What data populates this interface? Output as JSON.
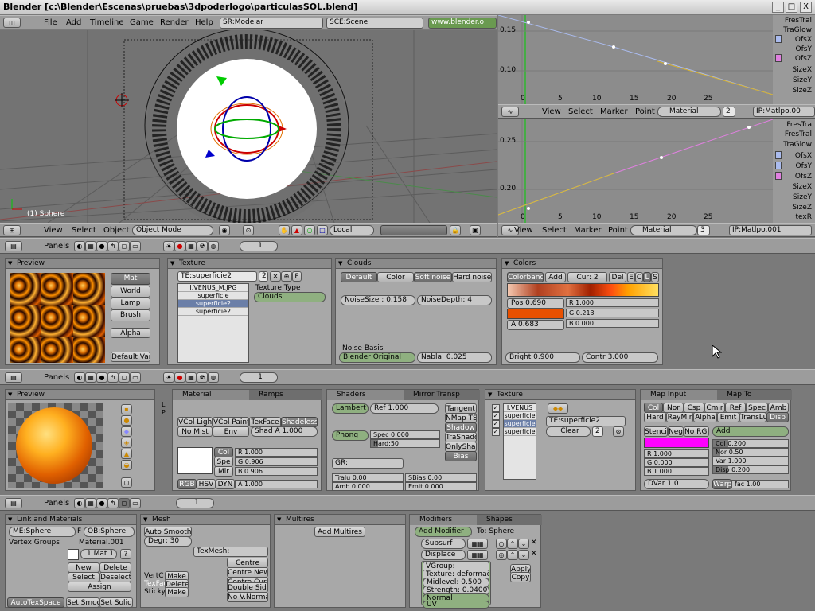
{
  "window": {
    "title": "Blender [c:\\Blender\\Escenas\\pruebas\\3dpoderlogo\\particulasSOL.blend]",
    "min": "_",
    "max": "□",
    "close": "X"
  },
  "topmenu": {
    "items": [
      "File",
      "Add",
      "Timeline",
      "Game",
      "Render",
      "Help"
    ],
    "screen": "SR:Modelar",
    "scene": "SCE:Scene",
    "url": "www.blender.o"
  },
  "view3d": {
    "object_label": "(1) Sphere",
    "menu": [
      "View",
      "Select",
      "Object"
    ],
    "mode": "Object Mode",
    "orient": "Local"
  },
  "ipo_top": {
    "y_ticks": [
      "0.15",
      "0.10"
    ],
    "x_ticks": [
      "0",
      "5",
      "10",
      "15",
      "20",
      "25"
    ],
    "channels": [
      "FresTral",
      "TraGlow",
      "OfsX",
      "OfsY",
      "OfsZ",
      "SizeX",
      "SizeY",
      "SizeZ"
    ],
    "menu": [
      "View",
      "Select",
      "Marker",
      "Point"
    ],
    "type": "Material",
    "num": "2",
    "block": "IP:Matlpo.00"
  },
  "ipo_bot": {
    "y_ticks": [
      "0.25",
      "0.20"
    ],
    "x_ticks": [
      "0",
      "5",
      "10",
      "15",
      "20",
      "25"
    ],
    "channels": [
      "FresTra",
      "FresTral",
      "TraGlow",
      "OfsX",
      "OfsY",
      "OfsZ",
      "SizeX",
      "SizeY",
      "SizeZ",
      "texR"
    ],
    "menu": [
      "View",
      "Select",
      "Marker",
      "Point"
    ],
    "type": "Material",
    "num": "3",
    "block": "IP:Matlpo.001"
  },
  "buttons1": {
    "panels_label": "Panels",
    "frame": "1",
    "preview": {
      "title": "Preview",
      "tabs": [
        "Mat",
        "World",
        "Lamp",
        "Brush"
      ],
      "alpha": "Alpha",
      "default_vars": "Default Vars"
    },
    "texture": {
      "title": "Texture",
      "name": "TE:superficie2",
      "users": "2",
      "fake": "F",
      "list": [
        "I.VENUS_M.JPG",
        "superficie",
        "superficie2",
        "superficie2"
      ],
      "type_label": "Texture Type",
      "type": "Clouds"
    },
    "clouds": {
      "title": "Clouds",
      "modes": [
        "Default",
        "Color",
        "Soft noise",
        "Hard noise"
      ],
      "noise_size": "NoiseSize : 0.158",
      "noise_depth": "NoiseDepth: 4",
      "basis_label": "Noise Basis",
      "basis": "Blender Original",
      "nabla": "Nabla: 0.025"
    },
    "colors": {
      "title": "Colors",
      "colorband": "Colorband",
      "add": "Add",
      "cur": "Cur: 2",
      "del": "Del",
      "ecls": [
        "E",
        "C",
        "L",
        "S"
      ],
      "pos": "Pos 0.690",
      "a": "A 0.683",
      "r": "R 1.000",
      "g": "G 0.213",
      "b": "B 0.000",
      "bright": "Bright 0.900",
      "contr": "Contr 3.000"
    }
  },
  "buttons2": {
    "panels_label": "Panels",
    "frame": "1",
    "preview": {
      "title": "Preview",
      "side": [
        "L",
        "P"
      ]
    },
    "material": {
      "tabs": [
        "Material",
        "Ramps"
      ],
      "row1": [
        "VCol Light",
        "VCol Paint",
        "TexFace",
        "Shadeless"
      ],
      "row2": [
        "No Mist",
        "Env",
        "Shad A 1.000"
      ],
      "cs": [
        "Col",
        "Spe",
        "Mir"
      ],
      "r": "R 1.000",
      "g": "G 0.906",
      "b": "B 0.906",
      "modes": [
        "RGB",
        "HSV",
        "DYN"
      ],
      "a": "A 1.000"
    },
    "shaders": {
      "tabs": [
        "Shaders",
        "Mirror Transp"
      ],
      "diffuse": "Lambert",
      "ref": "Ref  1.000",
      "spec": "Phong",
      "specv": "Spec 0.000",
      "hard": "Hard:50",
      "gr": "GR:",
      "right": [
        "Tangent",
        "NMap TS",
        "Shadow",
        "TraShado",
        "OnlyShad",
        "Bias"
      ],
      "tralu": "Tralu 0.00",
      "sbias": "SBias 0.00",
      "amb": "Amb 0.000",
      "emit": "Emit 0.000"
    },
    "texture": {
      "title": "Texture",
      "list": [
        "I.VENUS",
        "superficie",
        "superficie",
        "superficie"
      ],
      "name": "TE:superficie2",
      "clear": "Clear",
      "num": "2"
    },
    "mapinput": {
      "tabs": [
        "Map Input",
        "Map To"
      ],
      "row1": [
        "Col",
        "Nor",
        "Csp",
        "Cmir",
        "Ref",
        "Spec",
        "Amb"
      ],
      "row2": [
        "Hard",
        "RayMir",
        "Alpha",
        "Emit",
        "TransLu",
        "Disp"
      ],
      "row3": [
        "Stencil",
        "Neg",
        "No RGB"
      ],
      "blend": "Add",
      "r": "R 1.000",
      "g": "G 0.000",
      "b": "B 1.000",
      "col": "Col 0.200",
      "nor": "Nor 0.50",
      "var": "Var 1.000",
      "disp": "Disp 0.200",
      "dvar": "DVar 1.0",
      "warp": "Warp",
      "fac": "fac 1.00"
    }
  },
  "buttons3": {
    "panels_label": "Panels",
    "frame": "1",
    "link": {
      "title": "Link and Materials",
      "me": "ME:Sphere",
      "f": "F",
      "ob": "OB:Sphere",
      "vgroups": "Vertex Groups",
      "mat": "Material.001",
      "matnum": "1 Mat 1",
      "q": "?",
      "new": "New",
      "delete": "Delete",
      "select": "Select",
      "deselect": "Deselect",
      "assign": "Assign",
      "autotex": "AutoTexSpace",
      "setsmoo": "Set Smoo",
      "setsolid": "Set Solid"
    },
    "mesh": {
      "title": "Mesh",
      "autosmooth": "Auto Smooth",
      "degr": "Degr: 30",
      "texmesh": "TexMesh:",
      "centre": [
        "Centre",
        "Centre New",
        "Centre Curs"
      ],
      "vertc": "VertC",
      "texfac": "TexFac",
      "sticky": "Sticky",
      "make": "Make",
      "delete": "Delete",
      "double": "Double Sided",
      "nov": "No V.Normal"
    },
    "multires": {
      "title": "Multires",
      "add": "Add Multires"
    },
    "modifiers": {
      "tabs": [
        "Modifiers",
        "Shapes"
      ],
      "add": "Add Modifier",
      "to": "To: Sphere",
      "m1": "Subsurf",
      "m2": "Displace",
      "vgroup": "VGroup:",
      "texture": "Texture: deformacion",
      "midlevel": "Midlevel: 0.500",
      "strength": "Strength: 0.0400",
      "normal": "Normal",
      "uv": "UV",
      "apply": "Apply",
      "copy": "Copy"
    }
  },
  "colors": {
    "accent": "#e85000",
    "header": "#9c9c9c",
    "panel": "#a8a8a8",
    "view3d": "#737373",
    "ipo": "#8c8c8c"
  }
}
